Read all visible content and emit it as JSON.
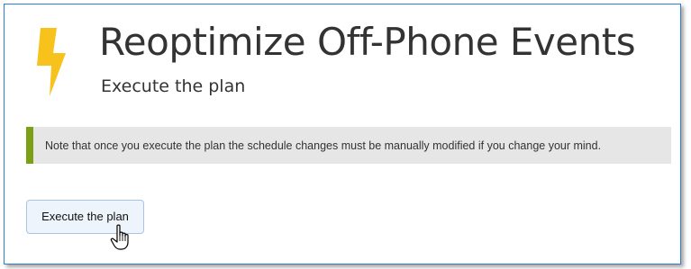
{
  "page": {
    "title": "Reoptimize Off-Phone Events",
    "subtitle": "Execute the plan"
  },
  "note": {
    "text": "Note that once you execute the plan the schedule changes must be manually modified if you change your mind."
  },
  "actions": {
    "execute_label": "Execute the plan"
  },
  "icons": {
    "header_icon": "lightning-bolt-icon",
    "pointer": "hand-pointer-cursor-icon"
  },
  "colors": {
    "bolt": "#f7c21c",
    "note_accent": "#7aa016",
    "frame_border": "#2b7fd6"
  }
}
